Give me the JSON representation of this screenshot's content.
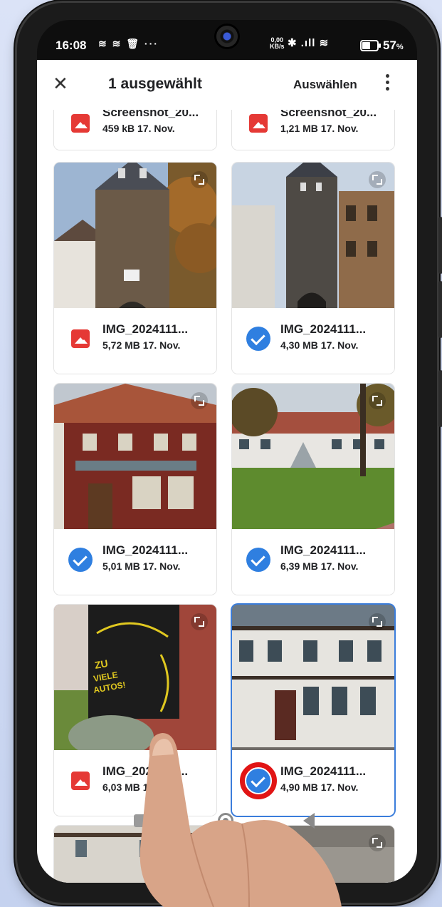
{
  "status": {
    "time": "16:08",
    "icons": "≋ ≋ 🗑 ···",
    "rate_value": "0,00",
    "rate_unit": "KB/s",
    "signal": "✱ .ıll ≋",
    "battery": "57",
    "battery_suffix": "%"
  },
  "appbar": {
    "close_label": "✕",
    "title": "1 ausgewählt",
    "select_label": "Auswählen"
  },
  "files": [
    {
      "name": "Screenshot_20...",
      "info": "459 kB 17. Nov.",
      "selected": false
    },
    {
      "name": "Screenshot_20...",
      "info": "1,21 MB 17. Nov.",
      "selected": false
    },
    {
      "name": "IMG_2024111...",
      "info": "5,72 MB 17. Nov.",
      "selected": false
    },
    {
      "name": "IMG_2024111...",
      "info": "4,30 MB 17. Nov.",
      "selected": true
    },
    {
      "name": "IMG_2024111...",
      "info": "5,01 MB 17. Nov.",
      "selected": true
    },
    {
      "name": "IMG_2024111...",
      "info": "6,39 MB 17. Nov.",
      "selected": true
    },
    {
      "name": "IMG_2024111...",
      "info": "6,03 MB 17. Nov.",
      "selected": false
    },
    {
      "name": "IMG_2024111...",
      "info": "4,90 MB 17. Nov.",
      "selected": true
    }
  ],
  "colors": {
    "accent": "#2f7fe0",
    "highlight_ring": "#e11515",
    "file_icon": "#e53935"
  },
  "icons": {
    "close": "close-icon",
    "more": "more-vert-icon",
    "image_file": "image-file-icon",
    "checked": "check-circle-icon",
    "expand": "expand-icon",
    "nav_recent": "recents-icon",
    "nav_home": "home-icon",
    "nav_back": "back-icon"
  }
}
